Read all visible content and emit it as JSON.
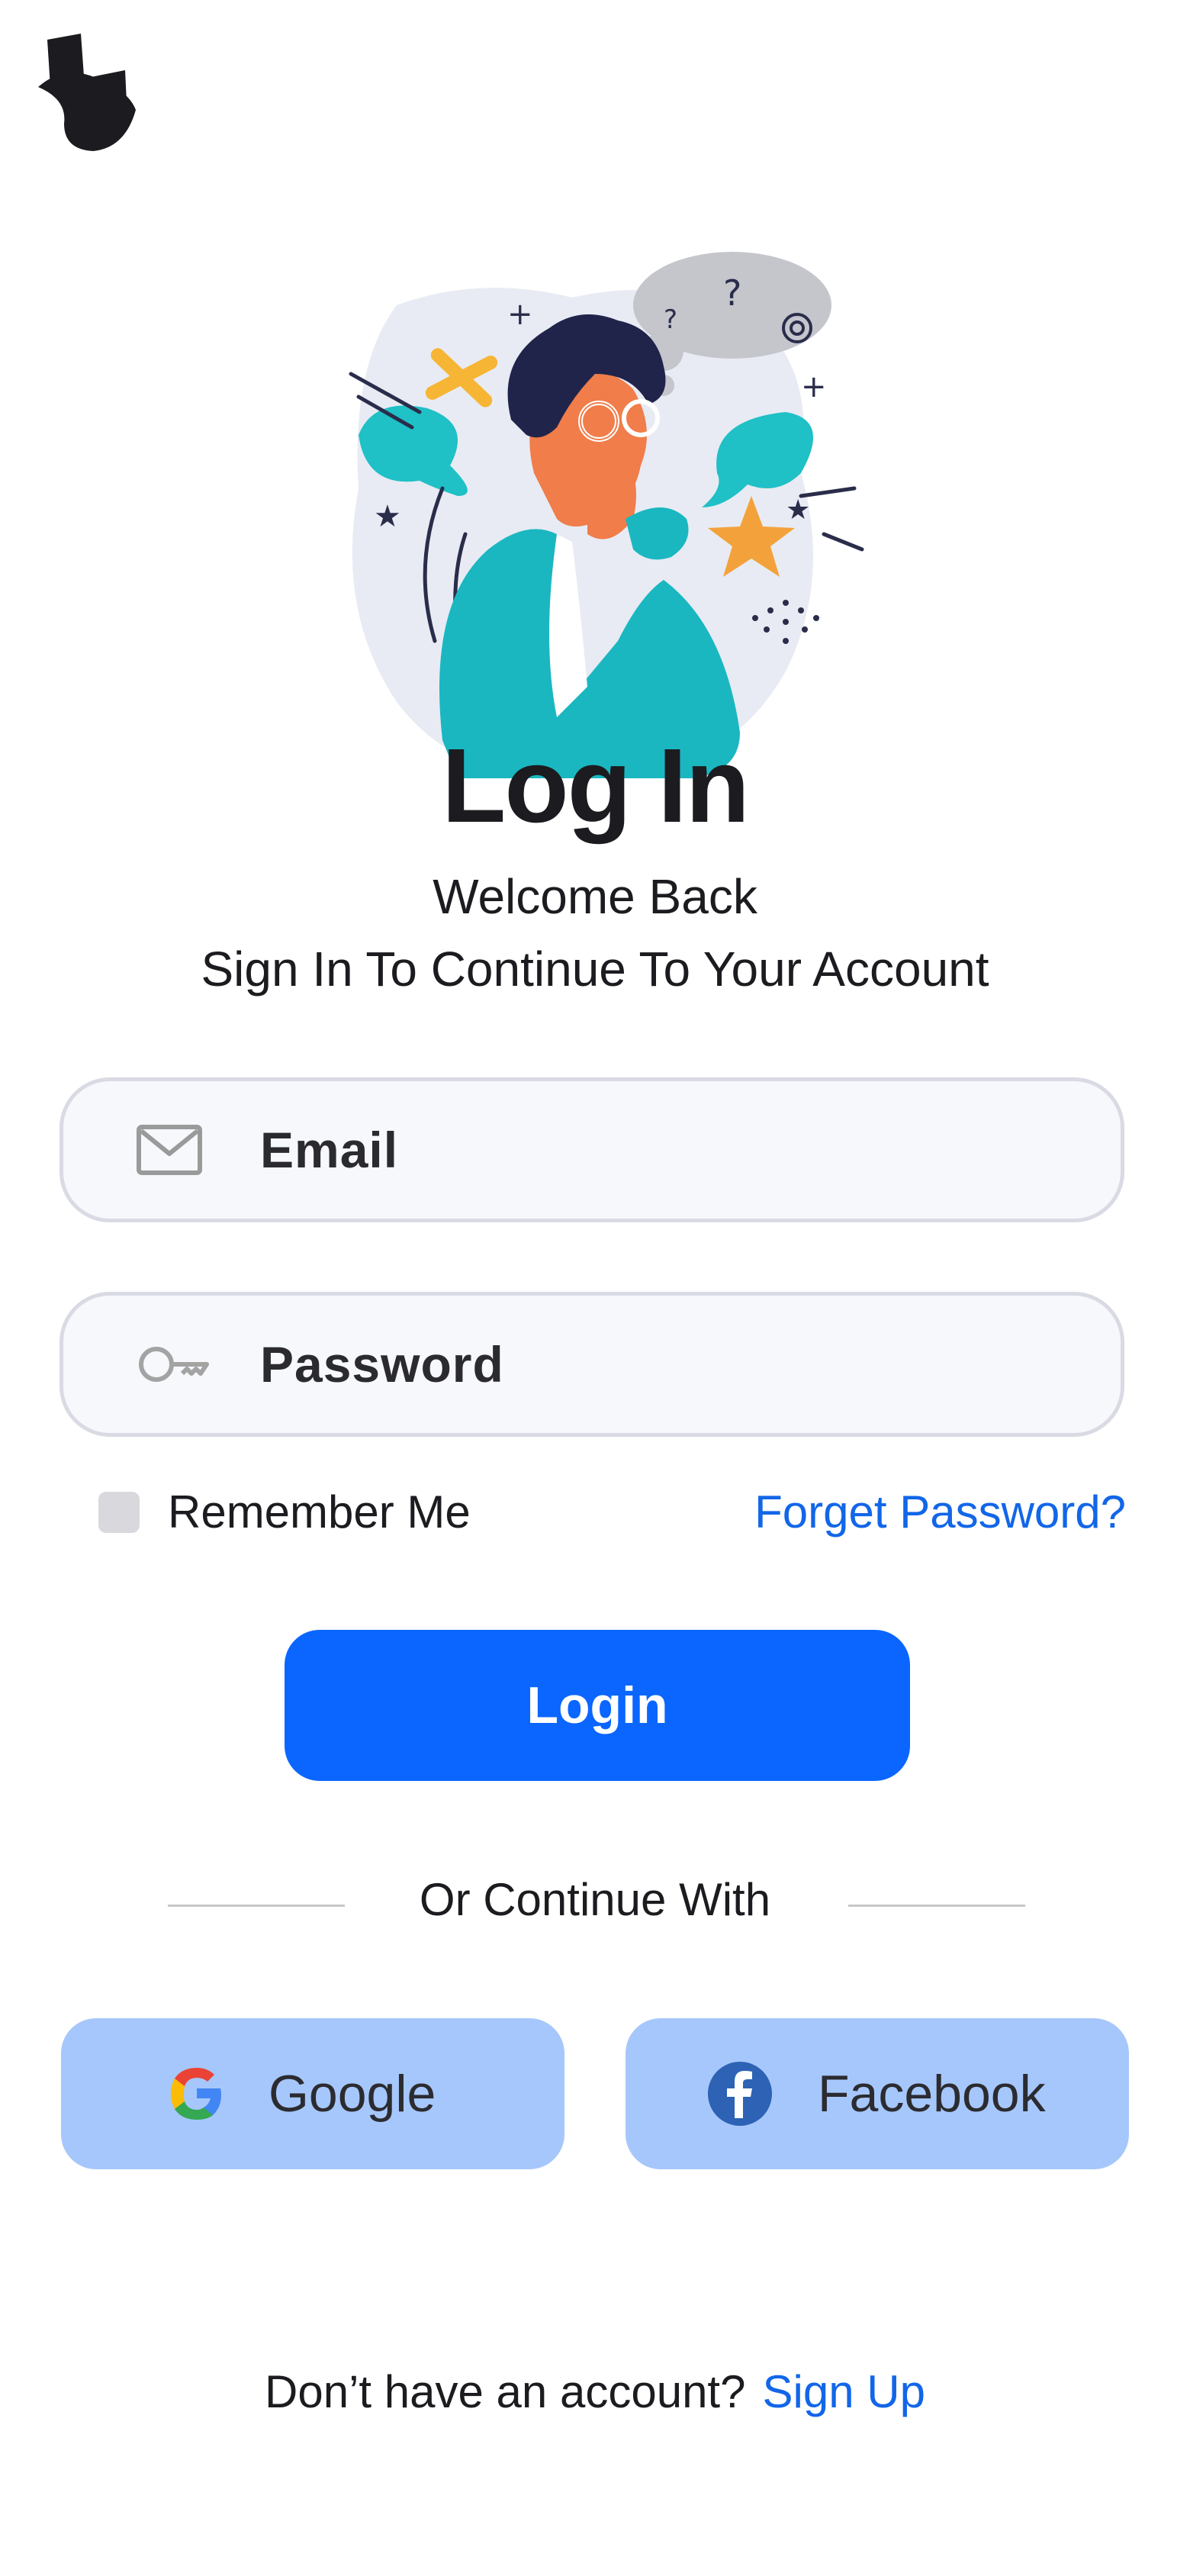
{
  "logo": {
    "icon": "app-logo-icon"
  },
  "illustration": {
    "icon": "thinking-person-illustration"
  },
  "header": {
    "title": "Log In",
    "welcome": "Welcome Back",
    "subtitle": "Sign In To Continue To Your Account"
  },
  "form": {
    "email": {
      "placeholder": "Email",
      "icon": "mail-icon"
    },
    "password": {
      "placeholder": "Password",
      "icon": "key-icon"
    },
    "remember_label": "Remember Me",
    "remember_checked": false,
    "forget_label": "Forget Password?",
    "login_label": "Login"
  },
  "divider": {
    "text": "Or Continue With"
  },
  "social": {
    "google_label": "Google",
    "facebook_label": "Facebook"
  },
  "footer": {
    "prompt": "Don’t have an account?",
    "signup_label": "Sign Up"
  },
  "colors": {
    "primary": "#0a66ff",
    "link": "#1266e8",
    "social_bg": "#a6c7fb",
    "field_bg": "#f6f8fc",
    "field_border": "#d9dae3"
  }
}
